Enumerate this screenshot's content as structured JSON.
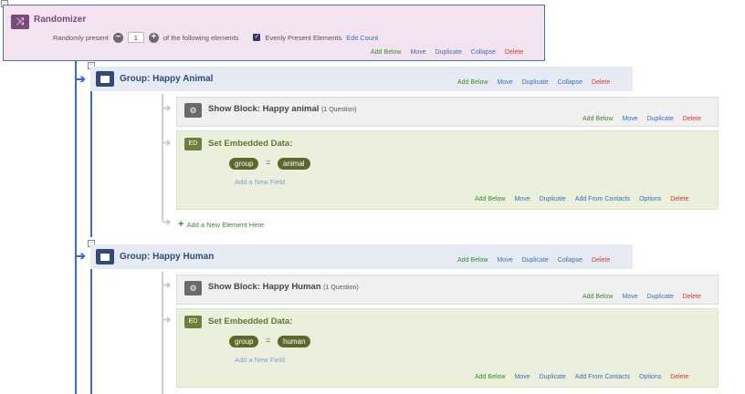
{
  "randomizer": {
    "icon": "shuffle-icon",
    "title": "Randomizer",
    "randomly_present_label": "Randomly present",
    "count": "1",
    "of_elements_label": "of the following elements",
    "evenly_present_label": "Evenly Present Elements",
    "evenly_present_checked": true,
    "edit_count_label": "Edit Count",
    "actions": {
      "add_below": "Add Below",
      "move": "Move",
      "duplicate": "Duplicate",
      "collapse": "Collapse",
      "delete": "Delete"
    }
  },
  "groups": [
    {
      "title": "Group: Happy Animal",
      "actions": {
        "add_below": "Add Below",
        "move": "Move",
        "duplicate": "Duplicate",
        "collapse": "Collapse",
        "delete": "Delete"
      },
      "block": {
        "title": "Show Block: Happy animal",
        "subtitle": "(1 Question)",
        "actions": {
          "add_below": "Add Below",
          "move": "Move",
          "duplicate": "Duplicate",
          "delete": "Delete"
        }
      },
      "embedded": {
        "icon_label": "ED",
        "title": "Set Embedded Data:",
        "field_name": "group",
        "equals": "=",
        "field_value": "animal",
        "add_field_label": "Add a New Field",
        "actions": {
          "add_below": "Add Below",
          "move": "Move",
          "duplicate": "Duplicate",
          "add_from_contacts": "Add From Contacts",
          "options": "Options",
          "delete": "Delete"
        }
      },
      "add_element_label": "Add a New Element Here"
    },
    {
      "title": "Group: Happy Human",
      "actions": {
        "add_below": "Add Below",
        "move": "Move",
        "duplicate": "Duplicate",
        "collapse": "Collapse",
        "delete": "Delete"
      },
      "block": {
        "title": "Show Block: Happy Human",
        "subtitle": "(1 Question)",
        "actions": {
          "add_below": "Add Below",
          "move": "Move",
          "duplicate": "Duplicate",
          "delete": "Delete"
        }
      },
      "embedded": {
        "icon_label": "ED",
        "title": "Set Embedded Data:",
        "field_name": "group",
        "equals": "=",
        "field_value": "human",
        "add_field_label": "Add a New Field",
        "actions": {
          "add_below": "Add Below",
          "move": "Move",
          "duplicate": "Duplicate",
          "add_from_contacts": "Add From Contacts",
          "options": "Options",
          "delete": "Delete"
        }
      }
    }
  ],
  "colors": {
    "accent_blue": "#3b6cc4",
    "randomizer_bg": "#f3e3f1",
    "randomizer_icon": "#7a4a7b",
    "group_bg": "#e6ebf3",
    "embed_bg": "#eaf0dc",
    "delete": "#d23a2f",
    "add_green": "#3a8a2e"
  }
}
